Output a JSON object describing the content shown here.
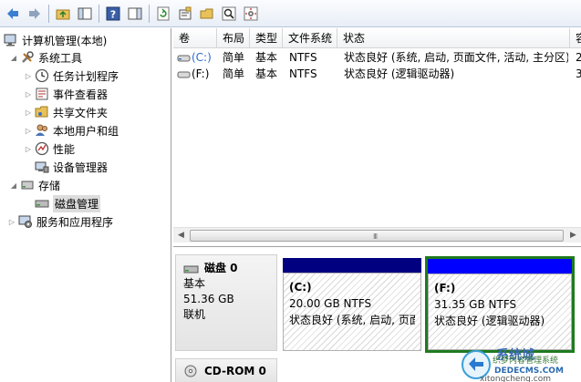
{
  "toolbar": {
    "buttons": [
      "back-icon",
      "forward-icon",
      "up-folder-icon",
      "show-hide-tree-icon",
      "help-icon",
      "action-pane-icon",
      "refresh-icon",
      "properties-icon",
      "open-icon",
      "search-icon",
      "settings-icon"
    ]
  },
  "tree": {
    "root": "计算机管理(本地)",
    "items": [
      {
        "label": "系统工具",
        "level": 1,
        "expanded": true
      },
      {
        "label": "任务计划程序",
        "level": 2
      },
      {
        "label": "事件查看器",
        "level": 2
      },
      {
        "label": "共享文件夹",
        "level": 2
      },
      {
        "label": "本地用户和组",
        "level": 2
      },
      {
        "label": "性能",
        "level": 2
      },
      {
        "label": "设备管理器",
        "level": 2
      },
      {
        "label": "存储",
        "level": 1,
        "expanded": true
      },
      {
        "label": "磁盘管理",
        "level": 2,
        "selected": true
      },
      {
        "label": "服务和应用程序",
        "level": 1
      }
    ]
  },
  "volumes": {
    "headers": [
      "卷",
      "布局",
      "类型",
      "文件系统",
      "状态",
      "容"
    ],
    "rows": [
      {
        "volume": "(C:)",
        "layout": "简单",
        "type": "基本",
        "fs": "NTFS",
        "status": "状态良好 (系统, 启动, 页面文件, 活动, 主分区)",
        "cap": "2"
      },
      {
        "volume": "(F:)",
        "layout": "简单",
        "type": "基本",
        "fs": "NTFS",
        "status": "状态良好 (逻辑驱动器)",
        "cap": "3"
      }
    ],
    "scroll_grip": "III"
  },
  "disk0": {
    "name": "磁盘 0",
    "kind": "基本",
    "size": "51.36 GB",
    "state": "联机",
    "partitions": [
      {
        "label": "(C:)",
        "size": "20.00 GB NTFS",
        "status": "状态良好 (系统, 启动, 页面",
        "bar_color": "#000080"
      },
      {
        "label": "(F:)",
        "size": "31.35 GB NTFS",
        "status": "状态良好 (逻辑驱动器)",
        "bar_color": "#0000ff"
      }
    ]
  },
  "cdrom": {
    "name": "CD-ROM 0"
  },
  "watermark": {
    "line1": "系统城",
    "line2": "织梦内容管理系统",
    "line3": "DEDECMS.COM",
    "line4": "xitongcheng.com"
  }
}
